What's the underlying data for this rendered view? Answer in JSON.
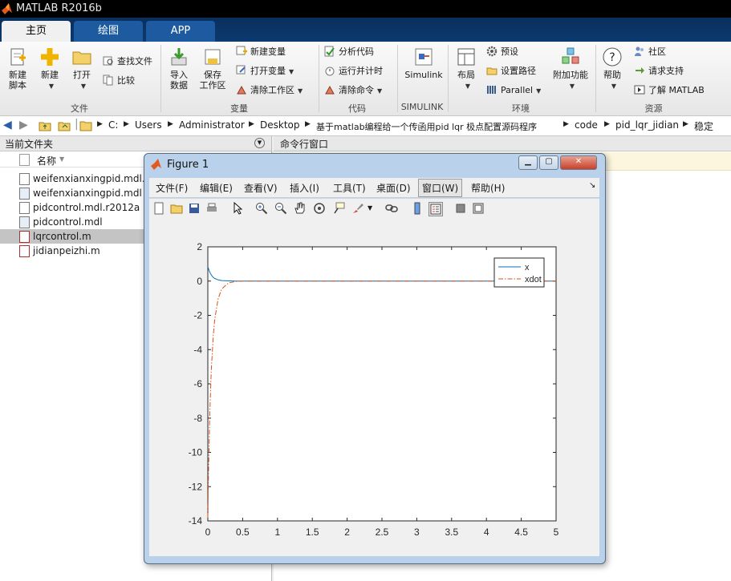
{
  "app": {
    "title": "MATLAB R2016b"
  },
  "tabs": [
    {
      "label": "主页"
    },
    {
      "label": "绘图"
    },
    {
      "label": "APP"
    }
  ],
  "ribbon": {
    "new_script": "新建\n脚本",
    "new": "新建",
    "open": "打开",
    "find_files": "查找文件",
    "compare": "比较",
    "import_data": "导入\n数据",
    "save_workspace": "保存\n工作区",
    "new_variable": "新建变量",
    "open_variable": "打开变量",
    "clear_workspace": "清除工作区",
    "analyze_code": "分析代码",
    "run_and_time": "运行并计时",
    "clear_commands": "清除命令",
    "simulink": "Simulink",
    "layout": "布局",
    "preferences": "预设",
    "set_path": "设置路径",
    "parallel": "Parallel",
    "addons": "附加功能",
    "help": "帮助",
    "community": "社区",
    "request_support": "请求支持",
    "learn_matlab": "了解 MATLAB",
    "groups": {
      "file": "文件",
      "variable": "变量",
      "code": "代码",
      "simulink": "SIMULINK",
      "environment": "环境",
      "resources": "资源"
    }
  },
  "address": {
    "crumbs": [
      "C:",
      "Users",
      "Administrator",
      "Desktop",
      "基于matlab编程给一个传函用pid lqr 极点配置源码程序",
      "code",
      "pid_lqr_jidian",
      "稳定"
    ]
  },
  "left_panel": {
    "title": "当前文件夹",
    "column_name": "名称",
    "files": [
      {
        "name": "weifenxianxingpid.mdl.r2012a",
        "selected": false,
        "type": "file"
      },
      {
        "name": "weifenxianxingpid.mdl",
        "selected": false,
        "type": "model"
      },
      {
        "name": "pidcontrol.mdl.r2012a",
        "selected": false,
        "type": "file"
      },
      {
        "name": "pidcontrol.mdl",
        "selected": false,
        "type": "model"
      },
      {
        "name": "lqrcontrol.m",
        "selected": true,
        "type": "script"
      },
      {
        "name": "jidianpeizhi.m",
        "selected": false,
        "type": "script"
      }
    ]
  },
  "command_window": {
    "title": "命令行窗口"
  },
  "figure": {
    "title": "Figure 1",
    "menus": [
      "文件(F)",
      "编辑(E)",
      "查看(V)",
      "插入(I)",
      "工具(T)",
      "桌面(D)",
      "窗口(W)",
      "帮助(H)"
    ],
    "colors": {
      "x": "#0072bd",
      "xdot": "#d95319"
    }
  },
  "chart_data": {
    "type": "line",
    "title": "",
    "xlabel": "",
    "ylabel": "",
    "xlim": [
      0,
      5
    ],
    "ylim": [
      -14,
      2
    ],
    "xticks": [
      "0",
      "0.5",
      "1",
      "1.5",
      "2",
      "2.5",
      "3",
      "3.5",
      "4",
      "4.5",
      "5"
    ],
    "yticks": [
      "2",
      "0",
      "-2",
      "-4",
      "-6",
      "-8",
      "-10",
      "-12",
      "-14"
    ],
    "legend": {
      "placement": "top-right",
      "entries": [
        "x",
        "xdot"
      ]
    },
    "grid": false,
    "series": [
      {
        "name": "x",
        "style": "solid",
        "x": [
          0,
          0.02,
          0.04,
          0.06,
          0.08,
          0.1,
          0.15,
          0.2,
          0.3,
          0.4,
          0.5,
          1,
          5
        ],
        "y": [
          0.85,
          0.6,
          0.42,
          0.3,
          0.21,
          0.15,
          0.07,
          0.03,
          0.01,
          0.0,
          0.0,
          0.0,
          0.0
        ]
      },
      {
        "name": "xdot",
        "style": "dashdot",
        "x": [
          0,
          0.01,
          0.03,
          0.05,
          0.08,
          0.1,
          0.15,
          0.2,
          0.3,
          0.4,
          0.5,
          1,
          5
        ],
        "y": [
          -13.8,
          -11,
          -7.5,
          -5.2,
          -3.1,
          -2.2,
          -1.0,
          -0.45,
          -0.1,
          -0.02,
          0.0,
          0.0,
          0.0
        ]
      }
    ]
  }
}
